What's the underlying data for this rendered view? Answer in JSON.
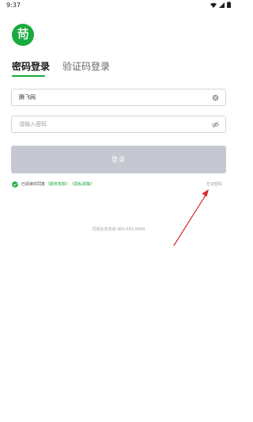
{
  "status_bar": {
    "time": "9:37",
    "icons": [
      "wifi-icon",
      "signal-icon",
      "battery-icon"
    ]
  },
  "logo": {
    "icon": "lotus-leaf-logo",
    "color": "#1aaa3e"
  },
  "tabs": [
    {
      "label": "密码登录",
      "active": true
    },
    {
      "label": "验证码登录",
      "active": false
    }
  ],
  "form": {
    "username": {
      "value": "腾飞网",
      "clear_icon": "clear-icon"
    },
    "password": {
      "value": "",
      "placeholder": "请输入密码",
      "toggle_icon": "eye-off-icon"
    },
    "login_label": "登录"
  },
  "agreement": {
    "checked": true,
    "text": "已阅读并同意",
    "terms_link": "《服务条款》",
    "privacy_link": "《隐私政策》"
  },
  "forgot_password": "忘记密码",
  "hotline": "同城业务咨询 400-091-9990",
  "colors": {
    "accent": "#1aaa3e",
    "button_disabled": "#c5c7d1",
    "annotation_arrow": "#d92b2b"
  }
}
